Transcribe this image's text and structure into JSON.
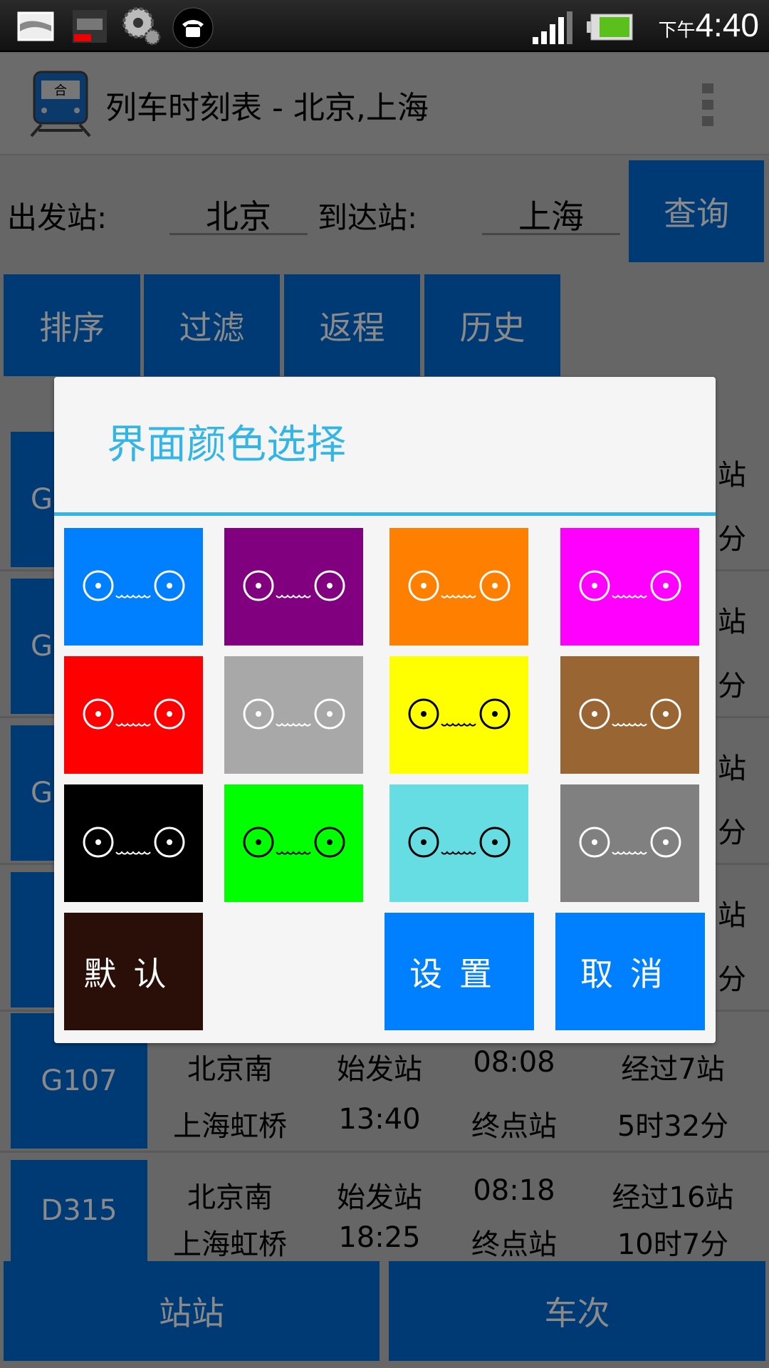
{
  "status_bar": {
    "time_prefix": "下午",
    "time": "4:40",
    "icons": [
      "gallery-icon",
      "recorder-icon",
      "settings-gears-icon",
      "phone-icon",
      "signal-icon",
      "battery-icon"
    ]
  },
  "action_bar": {
    "title": "列车时刻表 - 北京,上海",
    "icon": "train-icon",
    "overflow": "overflow-menu-icon"
  },
  "search": {
    "from_label": "出发站:",
    "from_value": "北京",
    "to_label": "到达站:",
    "to_value": "上海",
    "query_button": "查询"
  },
  "toolbar": {
    "sort": "排序",
    "filter": "过滤",
    "return": "返程",
    "history": "历史"
  },
  "list": {
    "partial_rows": [
      {
        "train": "G",
        "end": "站",
        "dur": "分"
      },
      {
        "train": "G",
        "end": "站",
        "dur": "分"
      },
      {
        "train": "G",
        "end": "站",
        "dur": "分"
      },
      {
        "train": "",
        "end": "站",
        "dur": "分"
      }
    ],
    "rows": [
      {
        "train": "G107",
        "from": "北京南",
        "from_type": "始发站",
        "depart": "08:08",
        "stops": "经过7站",
        "to": "上海虹桥",
        "arrive": "13:40",
        "to_type": "终点站",
        "duration": "5时32分"
      },
      {
        "train": "D315",
        "from": "北京南",
        "from_type": "始发站",
        "depart": "08:18",
        "stops": "经过16站",
        "to": "上海虹桥",
        "arrive": "18:25",
        "to_type": "终点站",
        "duration": "10时7分"
      }
    ]
  },
  "bottom_tabs": {
    "station": "站站",
    "train": "车次"
  },
  "dialog": {
    "title": "界面颜色选择",
    "accent": "#33b5e5",
    "swatches": [
      {
        "color": "#0080ff",
        "face": "#ffffff"
      },
      {
        "color": "#800080",
        "face": "#ffffff"
      },
      {
        "color": "#ff8000",
        "face": "#ffffff"
      },
      {
        "color": "#ff00ff",
        "face": "#ffffff"
      },
      {
        "color": "#ff0000",
        "face": "#ffffff"
      },
      {
        "color": "#a8a8a8",
        "face": "#ffffff"
      },
      {
        "color": "#ffff00",
        "face": "#000000"
      },
      {
        "color": "#996633",
        "face": "#ffffff"
      },
      {
        "color": "#000000",
        "face": "#ffffff"
      },
      {
        "color": "#00ff00",
        "face": "#000000"
      },
      {
        "color": "#66dde2",
        "face": "#000000"
      },
      {
        "color": "#808080",
        "face": "#ffffff"
      }
    ],
    "default_button": "默认",
    "default_color": "#2a0f08",
    "set_button": "设置",
    "cancel_button": "取消",
    "button_color": "#0080ff"
  }
}
